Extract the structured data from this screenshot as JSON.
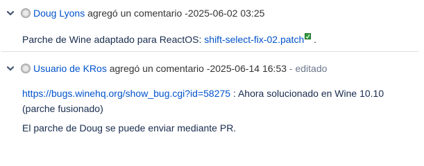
{
  "comments": [
    {
      "author": "Doug Lyons",
      "action": "agregó un comentario",
      "timestamp": "-2025-06-02 03:25",
      "edited": "",
      "body": {
        "text_before": "Parche de Wine adaptado para ReactOS: ",
        "link": "shift-select-fix-02.patch",
        "text_after": " ."
      }
    },
    {
      "author": "Usuario de KRos",
      "action": "agregó un comentario",
      "timestamp": "-2025-06-14 16:53",
      "edited": "- editado",
      "body": {
        "link": "https://bugs.winehq.org/show_bug.cgi?id=58275",
        "text_after": " : Ahora solucionado en Wine 10.10",
        "line2": "(parche fusionado)",
        "paragraph2": "El parche de Doug se puede enviar mediante PR."
      }
    }
  ],
  "colors": {
    "link": "#0052cc",
    "text": "#172b4d",
    "muted": "#6b778c",
    "divider": "#dcdfe4",
    "attachment_icon": "#2e9b3a"
  },
  "icons": [
    "chevron-down-icon",
    "avatar-icon",
    "attachment-icon"
  ]
}
